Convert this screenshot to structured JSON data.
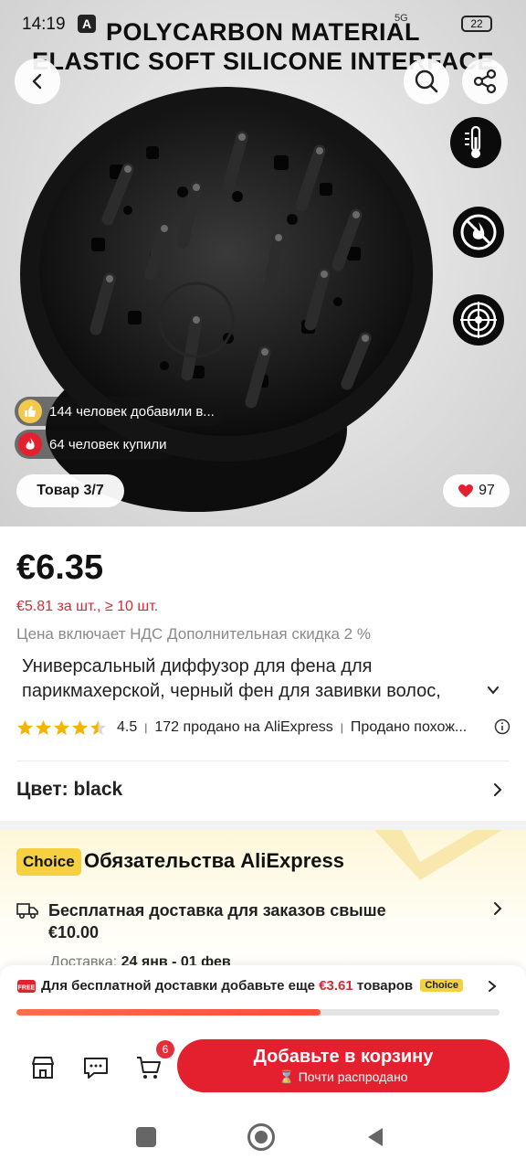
{
  "status_bar": {
    "time": "14:19",
    "notification_icon": "A",
    "network": "5G",
    "battery": "22"
  },
  "hero": {
    "banner_line1": "POLYCARBON MATERIAL",
    "banner_line2": "ELASTIC SOFT SILICONE INTERFACE",
    "added_chip": "144 человек добавили в...",
    "bought_chip": "64 человек купили",
    "counter_label": "Товар 3/7",
    "likes": "97"
  },
  "product": {
    "price": "€6.35",
    "bulk_price": "€5.81 за шт., ≥ 10 шт.",
    "vat_note": "Цена включает НДС Дополнительная скидка 2 %",
    "title_line1": "Универсальный диффузор для фена для",
    "title_line2": "парикмахерской, черный фен для завивки волос,",
    "rating": "4.5",
    "rating_stars": 4.5,
    "sold_text": "172 продано на AliExpress",
    "similar_text": "Продано похож...",
    "color_label": "Цвет: black"
  },
  "choice": {
    "badge": "Choice",
    "title": "Обязательства AliExpress",
    "shipping_line1": "Бесплатная доставка для заказов свыше",
    "shipping_line2": "€10.00",
    "delivery_label": "Доставка:",
    "delivery_dates": "24 янв - 01 фев"
  },
  "free_shipping_bar": {
    "text_before": "Для бесплатной доставки добавьте еще",
    "amount": "€3.61",
    "text_after": "товаров",
    "choice_tag": "Choice",
    "progress": 0.63
  },
  "bottom_bar": {
    "cart_count": "6",
    "add_to_cart": "Добавьте в корзину",
    "almost_sold_out": "Почти распродано"
  },
  "colors": {
    "accent_red": "#e4202e",
    "choice_yellow": "#f5d142",
    "price_red": "#d62a35"
  }
}
